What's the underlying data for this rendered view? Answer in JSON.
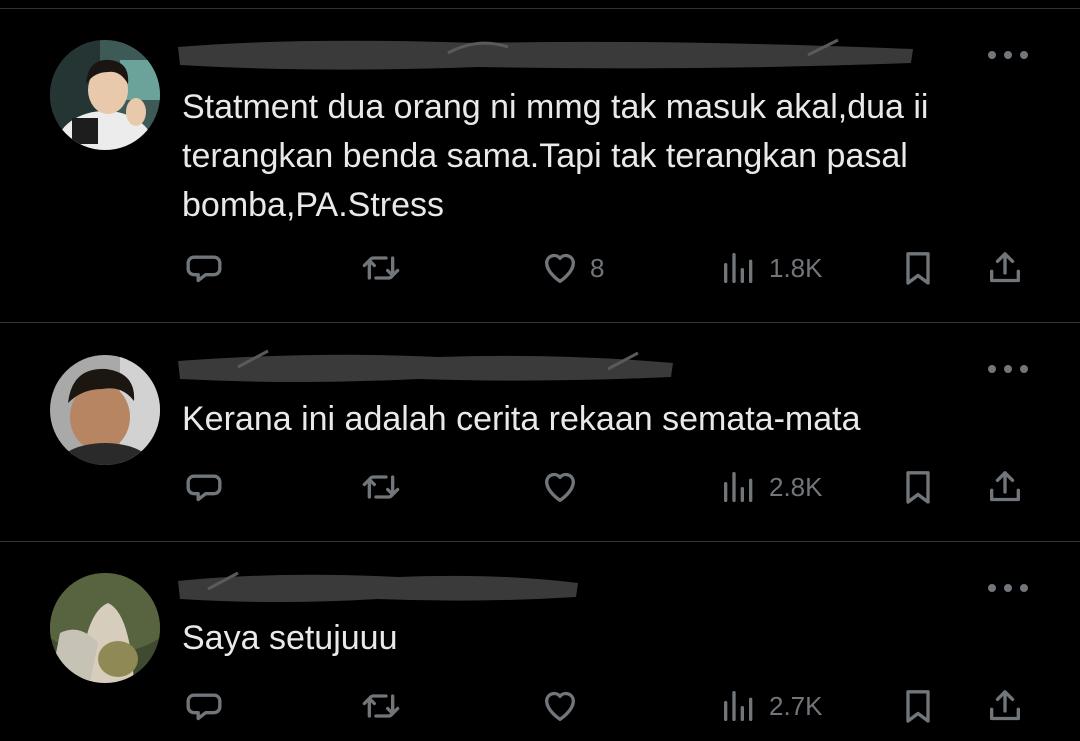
{
  "tweets": [
    {
      "text": "Statment dua orang ni mmg tak masuk akal,dua ii terangkan benda sama.Tapi tak terangkan pasal bomba,PA.Stress",
      "likes": "8",
      "views": "1.8K"
    },
    {
      "text": "Kerana ini adalah cerita rekaan semata-mata",
      "likes": "",
      "views": "2.8K"
    },
    {
      "text": "Saya setujuuu",
      "likes": "",
      "views": "2.7K"
    }
  ],
  "icons": {
    "reply": "reply-icon",
    "retweet": "retweet-icon",
    "like": "heart-icon",
    "views": "views-icon",
    "bookmark": "bookmark-icon",
    "share": "share-icon",
    "more": "more-icon"
  },
  "colors": {
    "background": "#000000",
    "text": "#e7e9ea",
    "secondary": "#71767b",
    "divider": "#2f3336"
  }
}
